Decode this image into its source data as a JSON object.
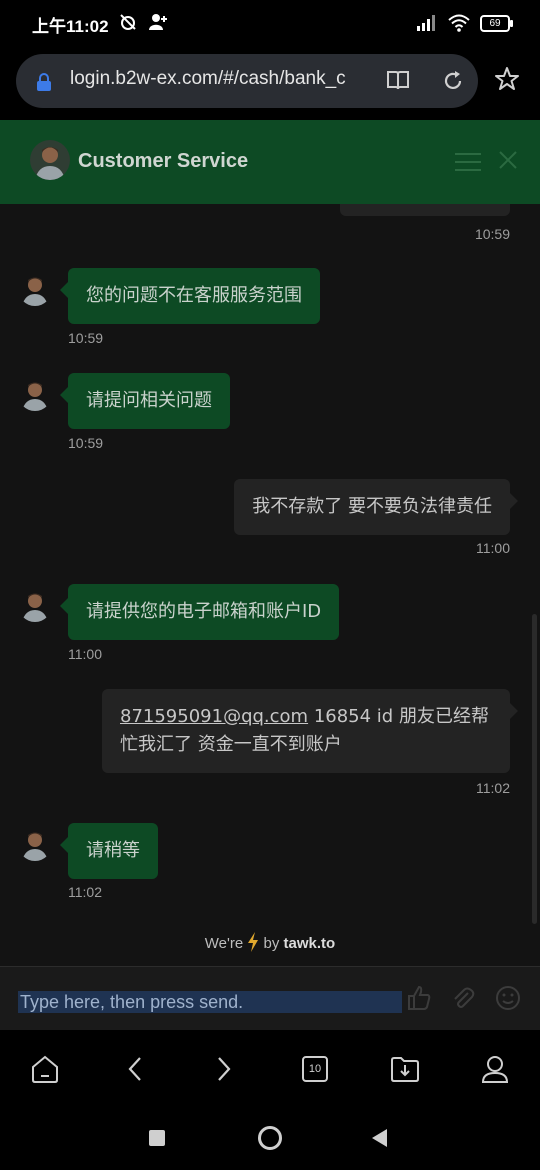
{
  "status_bar": {
    "time": "上午11:02",
    "battery": "69"
  },
  "browser": {
    "url": "login.b2w-ex.com/#/cash/bank_c"
  },
  "chat_header": {
    "title": "Customer Service"
  },
  "messages": [
    {
      "sender": "user",
      "text": "",
      "time": "10:59"
    },
    {
      "sender": "agent",
      "text": "您的问题不在客服服务范围",
      "time": "10:59"
    },
    {
      "sender": "agent",
      "text": "请提问相关问题",
      "time": "10:59"
    },
    {
      "sender": "user",
      "text": "我不存款了 要不要负法律责任",
      "time": "11:00"
    },
    {
      "sender": "agent",
      "text": "请提供您的电子邮箱和账户ID",
      "time": "11:00"
    },
    {
      "sender": "user",
      "link": "871595091@qq.com",
      "text": " 16854 id 朋友已经帮忙我汇了 资金一直不到账户",
      "time": "11:02"
    },
    {
      "sender": "agent",
      "text": "请稍等",
      "time": "11:02"
    }
  ],
  "powered_by": {
    "prefix": "We're",
    "middle": "by",
    "brand": "tawk.to"
  },
  "input": {
    "placeholder": "Type here, then press send."
  },
  "toolbar": {
    "tab_count": "10"
  },
  "icons": {
    "lock": "lock-icon",
    "book": "reader-mode-icon",
    "reload": "reload-icon",
    "star": "star-icon",
    "menu": "hamburger-menu-icon",
    "close": "close-icon",
    "thumb": "thumbs-up-icon",
    "attach": "paperclip-icon",
    "emoji": "emoji-icon"
  },
  "colors": {
    "header": "#0d4a24",
    "agent_bubble": "#0d4a24",
    "user_bubble": "#232323",
    "bolt": "#e0a82e"
  }
}
